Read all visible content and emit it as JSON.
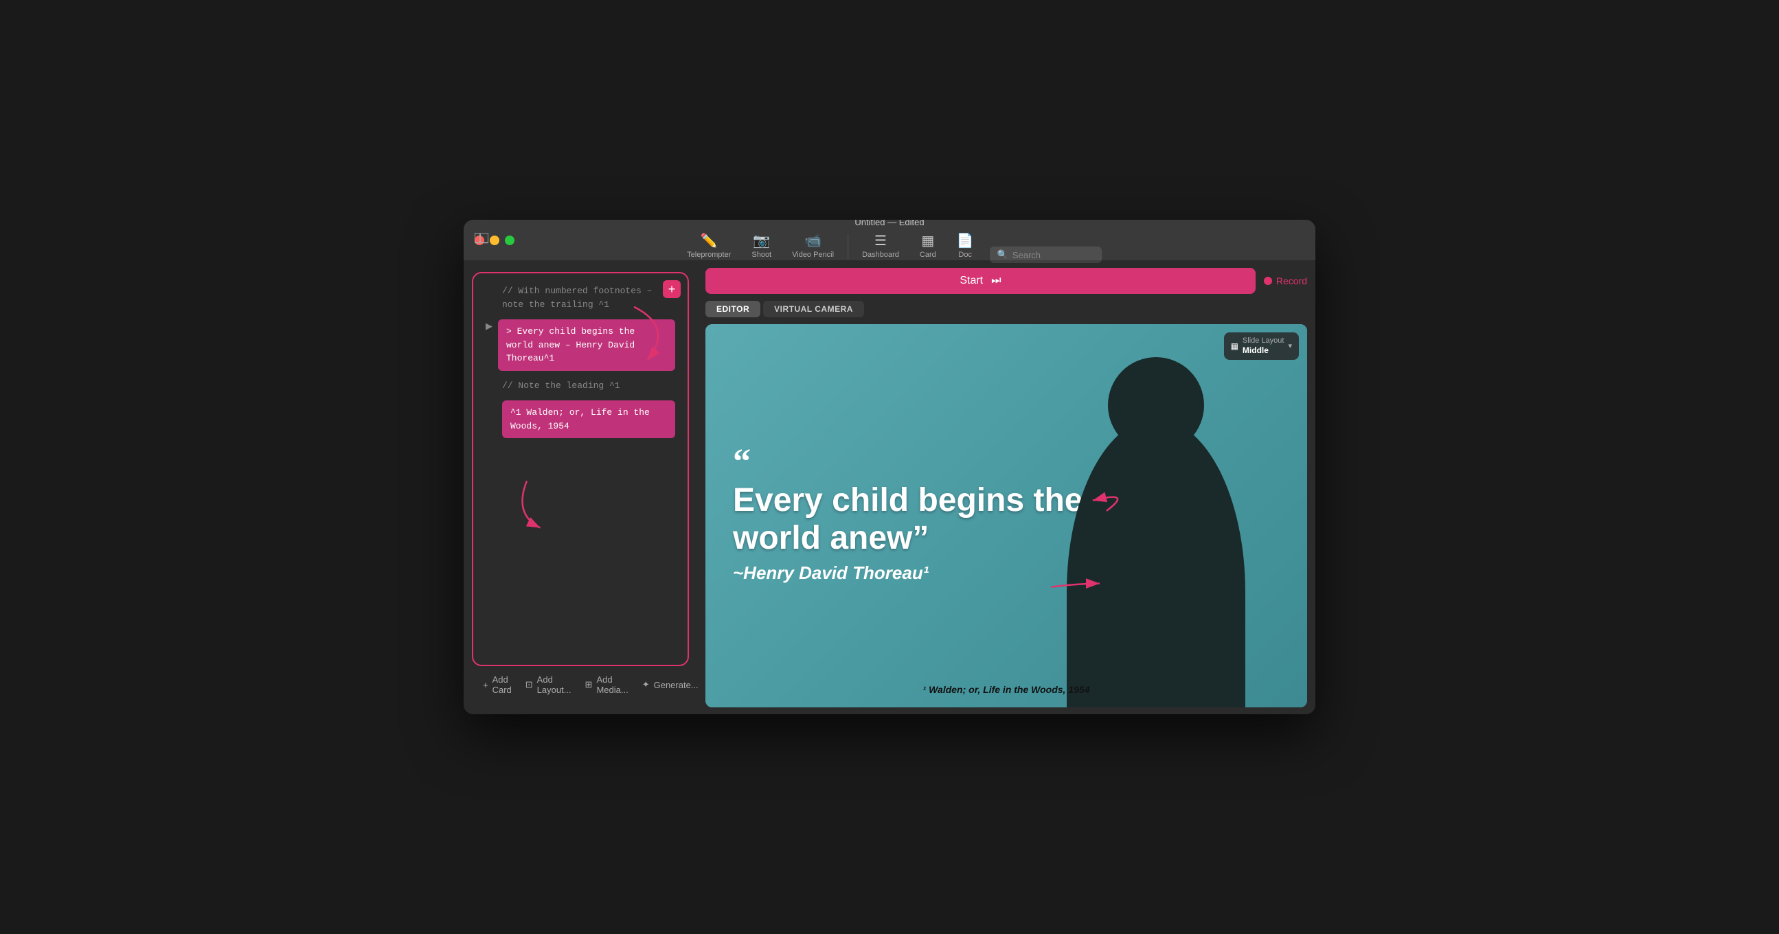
{
  "window": {
    "title": "Untitled — Edited"
  },
  "titlebar": {
    "traffic_lights": [
      "red",
      "yellow",
      "green"
    ]
  },
  "toolbar": {
    "items": [
      {
        "id": "teleprompter",
        "label": "Teleprompter",
        "icon": "✎"
      },
      {
        "id": "shoot",
        "label": "Shoot",
        "icon": "📷"
      },
      {
        "id": "video-pencil",
        "label": "Video Pencil",
        "icon": "📝"
      },
      {
        "id": "dashboard",
        "label": "Dashboard",
        "icon": "☰"
      },
      {
        "id": "card",
        "label": "Card",
        "icon": "▦"
      },
      {
        "id": "doc",
        "label": "Doc",
        "icon": "📄"
      }
    ],
    "search_placeholder": "Search"
  },
  "editor": {
    "card_add_btn": "+",
    "lines": [
      {
        "type": "comment",
        "text": "// With numbered footnotes – note the trailing ^1"
      },
      {
        "type": "quote",
        "text": "> Every child begins the world anew – Henry David Thoreau^1",
        "has_play": true
      },
      {
        "type": "comment",
        "text": "// Note the leading ^1"
      },
      {
        "type": "footnote",
        "text": "^1 Walden; or, Life in the Woods, 1954"
      }
    ],
    "bottom_actions": [
      {
        "icon": "+",
        "label": "Add Card"
      },
      {
        "icon": "⊡",
        "label": "Add Layout..."
      },
      {
        "icon": "⊞",
        "label": "Add Media..."
      },
      {
        "icon": "✦",
        "label": "Generate..."
      }
    ]
  },
  "controls": {
    "start_label": "Start",
    "skip_icon": "⏭",
    "record_label": "Record",
    "tabs": [
      {
        "id": "editor",
        "label": "EDITOR",
        "active": true
      },
      {
        "id": "virtual-camera",
        "label": "VIRTUAL CAMERA",
        "active": false
      }
    ]
  },
  "preview": {
    "quote_mark": "“",
    "quote_main": "Every child begins the world anew”",
    "quote_author": "~Henry David Thoreau¹",
    "footnote": "¹ Walden; or, Life in the Woods, 1954",
    "slide_layout_label": "Slide Layout",
    "slide_layout_value": "Middle"
  },
  "colors": {
    "accent_pink": "#d63472",
    "accent_pink_dark": "#c0337a",
    "preview_bg": "#5baab2"
  }
}
